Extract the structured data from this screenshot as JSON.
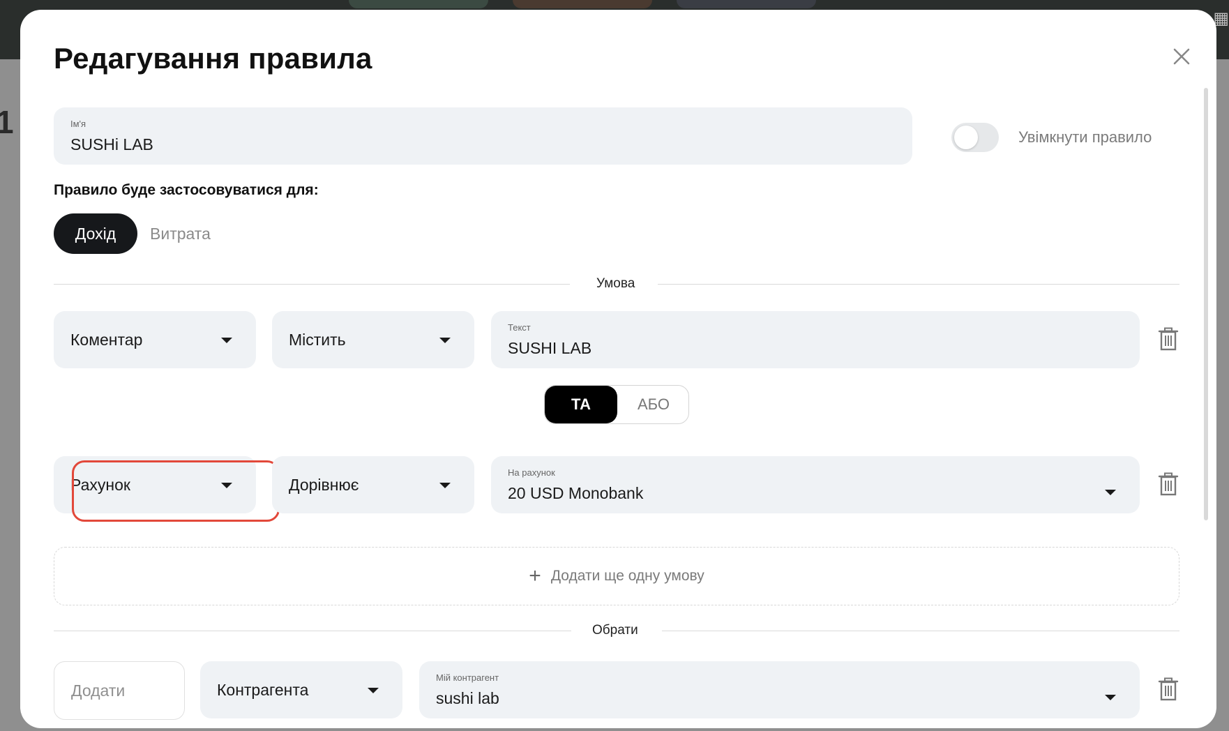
{
  "modal": {
    "title": "Редагування правила"
  },
  "name_field": {
    "label": "Ім'я",
    "value": "SUSHi LAB"
  },
  "enable_toggle": {
    "label": "Увімкнути правило",
    "on": false
  },
  "apply_for": {
    "label": "Правило буде застосовуватися для:",
    "options": [
      "Дохід",
      "Витрата"
    ],
    "selected": "Дохід"
  },
  "condition_section": {
    "label": "Умова",
    "rows": [
      {
        "field": "Коментар",
        "operator": "Містить",
        "value_label": "Текст",
        "value": "SUSHI LAB"
      },
      {
        "field": "Рахунок",
        "operator": "Дорівнює",
        "value_label": "На рахунок",
        "value": "20 USD Monobank"
      }
    ],
    "logic": {
      "and": "ТА",
      "or": "АБО",
      "selected": "ТА"
    },
    "add_label": "Додати ще одну умову"
  },
  "action_section": {
    "label": "Обрати",
    "action_placeholder": "Додати",
    "target": "Контрагента",
    "value_label": "Мій контрагент",
    "value": "sushi lab"
  },
  "colors": {
    "field_bg": "#eff2f5",
    "active_pill": "#16181b",
    "highlight": "#e2483a"
  }
}
